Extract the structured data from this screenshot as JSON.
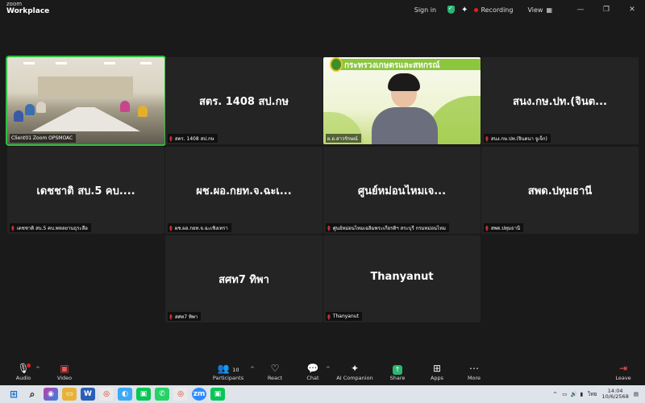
{
  "app": {
    "brand_top": "zoom",
    "brand_bottom": "Workplace"
  },
  "titlebar": {
    "sign_in": "Sign in",
    "recording": "Recording",
    "view": "View",
    "icons": [
      "shield-check-icon",
      "sparkle-icon",
      "grid-icon",
      "minimize-icon",
      "restore-icon",
      "close-icon"
    ]
  },
  "tiles": [
    {
      "display": "",
      "label": "Client01 Zoom OPSMOAC",
      "muted": false,
      "video": "meeting-room",
      "active": true
    },
    {
      "display": "สตร. 1408 สป.กษ",
      "label": "สตร. 1408 สป.กษ",
      "muted": true
    },
    {
      "display": "",
      "label": "ผ.อ.สาวรักษณ์",
      "muted": false,
      "video": "ministry",
      "banner": "กระทรวงเกษตรและสหกรณ์"
    },
    {
      "display": "สนง.กษ.ปท.(จินต...",
      "label": "สนง.กษ.ปท.(จินตนา จูเจ็ก)",
      "muted": true
    },
    {
      "display": "เดชชาติ สบ.5 คบ....",
      "label": "เดชชาติ สบ.5 คบ.พหลยานธุระลือ",
      "muted": true
    },
    {
      "display": "ผช.ผอ.กยท.จ.ฉะเ...",
      "label": "ผช.ผอ.กยท.จ.ฉะเชิงเทรา",
      "muted": true
    },
    {
      "display": "ศูนย์หม่อนไหมเจ...",
      "label": "ศูนย์หม่อนไหมเฉลิมพระเกียรติฯ สระบุรี กรมหม่อนไหม",
      "muted": true
    },
    {
      "display": "สพด.ปทุมธานี",
      "label": "สพด.ปทุมธานี",
      "muted": true
    },
    {
      "display": "สศท7 ทิพา",
      "label": "สศท7 ทิพา",
      "muted": true
    },
    {
      "display": "Thanyanut",
      "label": "Thanyanut",
      "muted": true
    }
  ],
  "toolbar": {
    "audio": "Audio",
    "video": "Video",
    "participants": "Participants",
    "participants_count": "10",
    "react": "React",
    "chat": "Chat",
    "ai_companion": "AI Companion",
    "share": "Share",
    "apps": "Apps",
    "more": "More",
    "leave": "Leave"
  },
  "taskbar": {
    "language": "ไทย",
    "time": "14:04",
    "date": "10/6/2568"
  }
}
